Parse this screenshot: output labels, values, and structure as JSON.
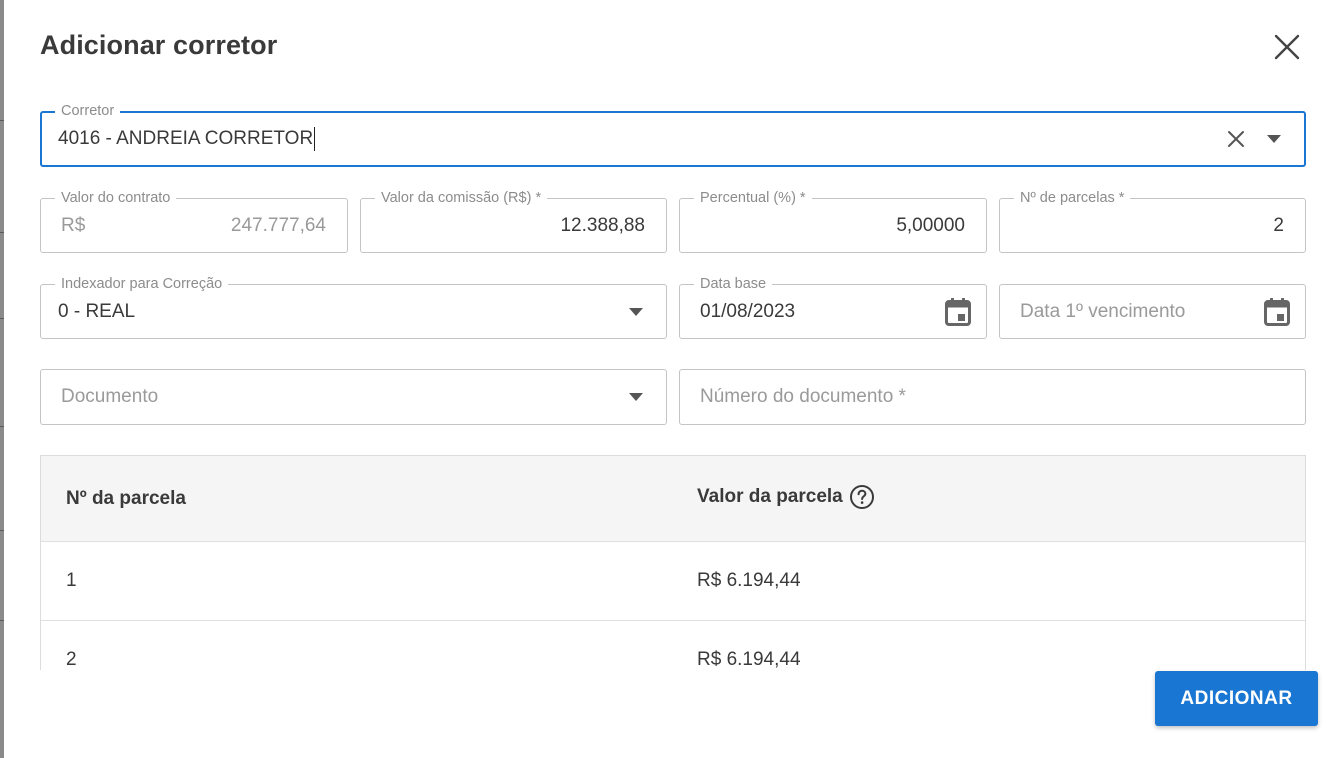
{
  "dialog": {
    "title": "Adicionar corretor",
    "close_icon": "close-icon"
  },
  "corretor": {
    "label": "Corretor",
    "value": "4016 - ANDREIA CORRETOR"
  },
  "valor_contrato": {
    "label": "Valor do contrato",
    "prefix": "R$",
    "value": "247.777,64"
  },
  "valor_comissao": {
    "label": "Valor da comissão (R$) *",
    "value": "12.388,88"
  },
  "percentual": {
    "label": "Percentual (%) *",
    "value": "5,00000"
  },
  "num_parcelas": {
    "label": "Nº de parcelas *",
    "value": "2"
  },
  "indexador": {
    "label": "Indexador para Correção",
    "value": "0 - REAL"
  },
  "data_base": {
    "label": "Data base",
    "value": "01/08/2023"
  },
  "data_vencimento": {
    "placeholder": "Data 1º vencimento"
  },
  "documento": {
    "placeholder": "Documento"
  },
  "numero_documento": {
    "placeholder": "Número do documento *"
  },
  "table": {
    "headers": [
      "Nº da parcela",
      "Valor da parcela"
    ],
    "rows": [
      {
        "numero": "1",
        "valor": "R$ 6.194,44"
      },
      {
        "numero": "2",
        "valor": "R$ 6.194,44"
      }
    ]
  },
  "actions": {
    "add_label": "ADICIONAR"
  },
  "colors": {
    "accent": "#1976d2",
    "border": "#c4c4c4",
    "header_bg": "#f5f5f5"
  }
}
